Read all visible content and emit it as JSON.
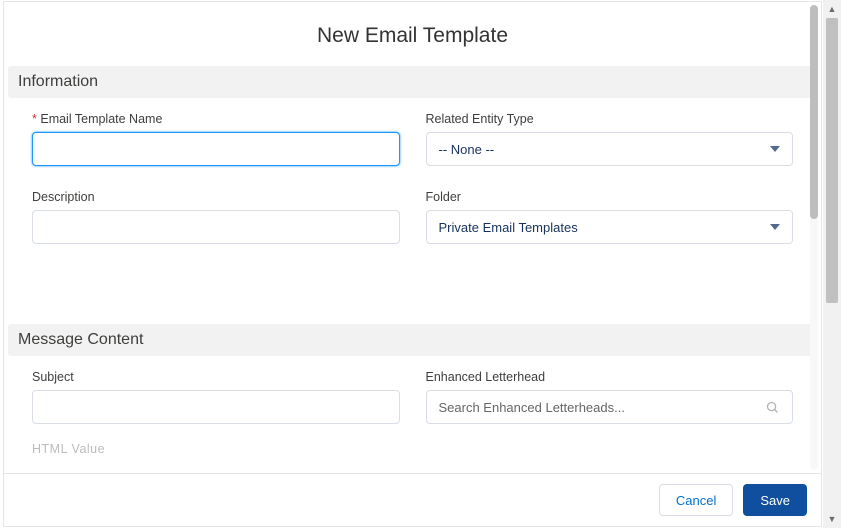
{
  "title": "New Email Template",
  "sections": {
    "information": {
      "heading": "Information",
      "template_name": {
        "label": "Email Template Name",
        "value": "",
        "required": true
      },
      "related_entity": {
        "label": "Related Entity Type",
        "value": "-- None --"
      },
      "description": {
        "label": "Description",
        "value": ""
      },
      "folder": {
        "label": "Folder",
        "value": "Private Email Templates"
      }
    },
    "message": {
      "heading": "Message Content",
      "subject": {
        "label": "Subject",
        "value": ""
      },
      "letterhead": {
        "label": "Enhanced Letterhead",
        "placeholder": "Search Enhanced Letterheads..."
      },
      "html_value": {
        "label_partial": "HTML Value"
      }
    }
  },
  "footer": {
    "cancel": "Cancel",
    "save": "Save"
  }
}
